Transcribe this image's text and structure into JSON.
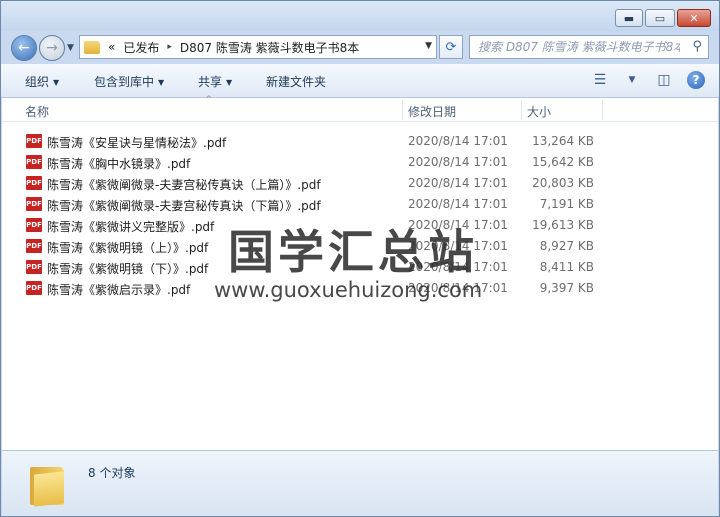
{
  "window": {
    "controls": {
      "minimize": "▬",
      "maximize": "▭",
      "close": "✕"
    }
  },
  "nav": {
    "back_icon": "back-arrow-icon",
    "forward_icon": "forward-arrow-icon",
    "back_glyph": "←",
    "forward_glyph": "→",
    "dropdown_glyph": "▼",
    "breadcrumb": [
      "«",
      "已发布",
      "▸",
      "D807 陈雪涛 紫薇斗数电子书8本"
    ],
    "refresh_glyph": "⟳",
    "search_placeholder": "搜索 D807 陈雪涛 紫薇斗数电子书8本",
    "search_glyph": "⚲"
  },
  "toolbar": {
    "organize": "组织",
    "include_in_library": "包含到库中",
    "share": "共享",
    "new_folder": "新建文件夹",
    "arrow": "▼"
  },
  "columns": {
    "name": "名称",
    "modified": "修改日期",
    "size": "大小",
    "sort_glyph": "^"
  },
  "files": [
    {
      "name": "陈雪涛《安星诀与星情秘法》.pdf",
      "modified": "2020/8/14 17:01",
      "size": "13,264 KB"
    },
    {
      "name": "陈雪涛《胸中水镜录》.pdf",
      "modified": "2020/8/14 17:01",
      "size": "15,642 KB"
    },
    {
      "name": "陈雪涛《紫微阐微录-夫妻宫秘传真诀（上篇）》.pdf",
      "modified": "2020/8/14 17:01",
      "size": "20,803 KB"
    },
    {
      "name": "陈雪涛《紫微阐微录-夫妻宫秘传真诀（下篇）》.pdf",
      "modified": "2020/8/14 17:01",
      "size": "7,191 KB"
    },
    {
      "name": "陈雪涛《紫微讲义完整版》.pdf",
      "modified": "2020/8/14 17:01",
      "size": "19,613 KB"
    },
    {
      "name": "陈雪涛《紫微明镜（上）》.pdf",
      "modified": "2020/8/14 17:01",
      "size": "8,927 KB"
    },
    {
      "name": "陈雪涛《紫微明镜（下）》.pdf",
      "modified": "2020/8/14 17:01",
      "size": "8,411 KB"
    },
    {
      "name": "陈雪涛《紫微启示录》.pdf",
      "modified": "2020/8/14 17:01",
      "size": "9,397 KB"
    }
  ],
  "file_icon_label": "PDF",
  "watermark": {
    "title": "国学汇总站",
    "url": "www.guoxuehuizong.com"
  },
  "status": {
    "count_text": "8 个对象"
  }
}
